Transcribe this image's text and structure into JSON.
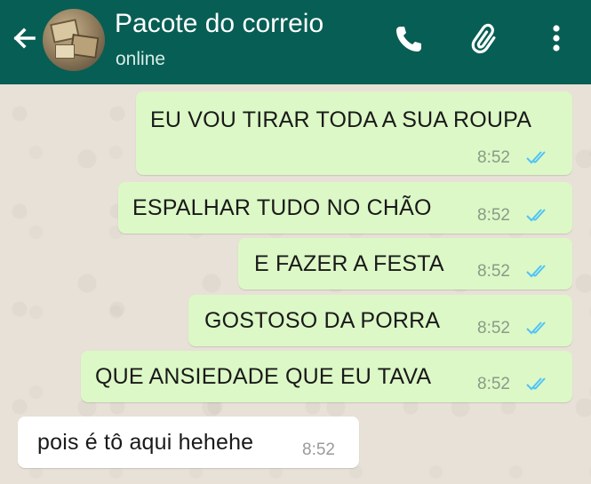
{
  "header": {
    "contact_name": "Pacote do correio",
    "status": "online"
  },
  "colors": {
    "header_bg": "#075e54",
    "outgoing_bubble": "#dcf8c6",
    "incoming_bubble": "#ffffff",
    "read_ticks": "#4fc3f7"
  },
  "icons": [
    "arrow-left-icon",
    "phone-icon",
    "paperclip-icon",
    "more-vertical-icon"
  ],
  "messages": [
    {
      "direction": "outgoing",
      "text": "EU VOU TIRAR TODA A SUA ROUPA",
      "time": "8:52",
      "status": "read"
    },
    {
      "direction": "outgoing",
      "text": "ESPALHAR TUDO NO CHÃO",
      "time": "8:52",
      "status": "read"
    },
    {
      "direction": "outgoing",
      "text": "E FAZER A FESTA",
      "time": "8:52",
      "status": "read"
    },
    {
      "direction": "outgoing",
      "text": "GOSTOSO DA PORRA",
      "time": "8:52",
      "status": "read"
    },
    {
      "direction": "outgoing",
      "text": "QUE ANSIEDADE QUE EU TAVA",
      "time": "8:52",
      "status": "read"
    },
    {
      "direction": "incoming",
      "text": "pois é tô aqui hehehe",
      "time": "8:52"
    }
  ]
}
